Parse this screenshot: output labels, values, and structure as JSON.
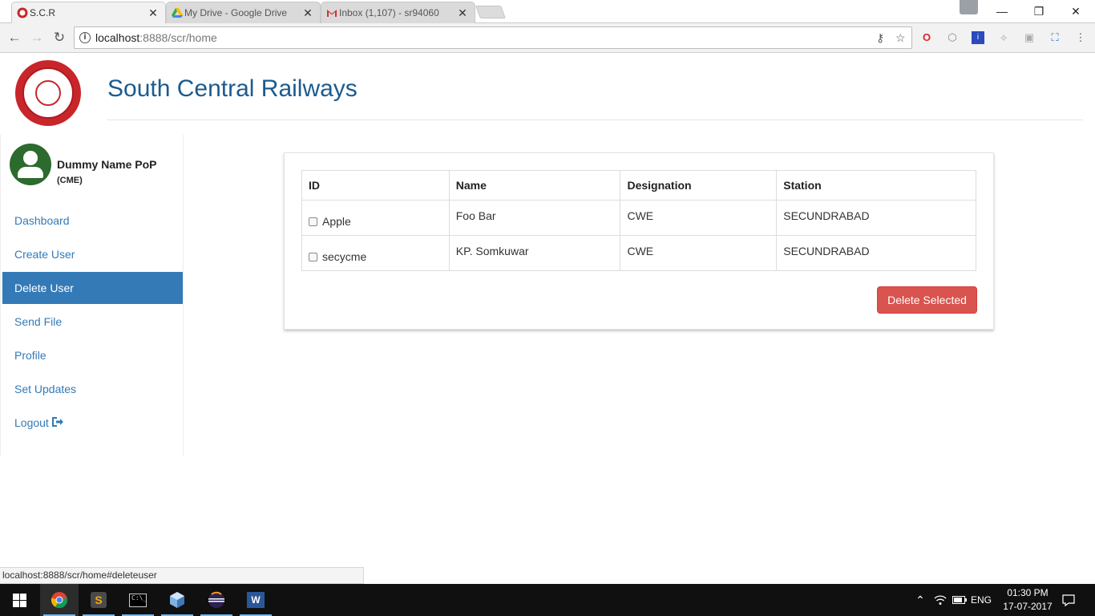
{
  "browser": {
    "tabs": [
      {
        "label": "S.C.R",
        "close": "✕"
      },
      {
        "label": "My Drive - Google Drive",
        "close": "✕"
      },
      {
        "label": "Inbox (1,107) - sr94060",
        "close": "✕"
      }
    ],
    "url_host": "localhost",
    "url_path": ":8888/scr/home",
    "status_url": "localhost:8888/scr/home#deleteuser"
  },
  "header": {
    "title": "South Central Railways"
  },
  "user": {
    "name": "Dummy Name PoP",
    "role": "(CME)"
  },
  "nav": {
    "items": [
      {
        "label": "Dashboard"
      },
      {
        "label": "Create User"
      },
      {
        "label": "Delete User"
      },
      {
        "label": "Send File"
      },
      {
        "label": "Profile"
      },
      {
        "label": "Set Updates"
      },
      {
        "label": "Logout"
      }
    ],
    "active": "Delete User"
  },
  "table": {
    "headers": [
      "ID",
      "Name",
      "Designation",
      "Station"
    ],
    "rows": [
      {
        "id": "Apple",
        "name": "Foo Bar",
        "designation": "CWE",
        "station": "SECUNDRABAD"
      },
      {
        "id": "secycme",
        "name": "KP. Somkuwar",
        "designation": "CWE",
        "station": "SECUNDRABAD"
      }
    ]
  },
  "actions": {
    "delete_label": "Delete Selected"
  },
  "taskbar": {
    "lang": "ENG",
    "time": "01:30 PM",
    "date": "17-07-2017"
  },
  "colors": {
    "brand": "#1b5b8f",
    "nav_active": "#337ab7",
    "danger": "#d9534f",
    "logo_red": "#c8262a"
  }
}
